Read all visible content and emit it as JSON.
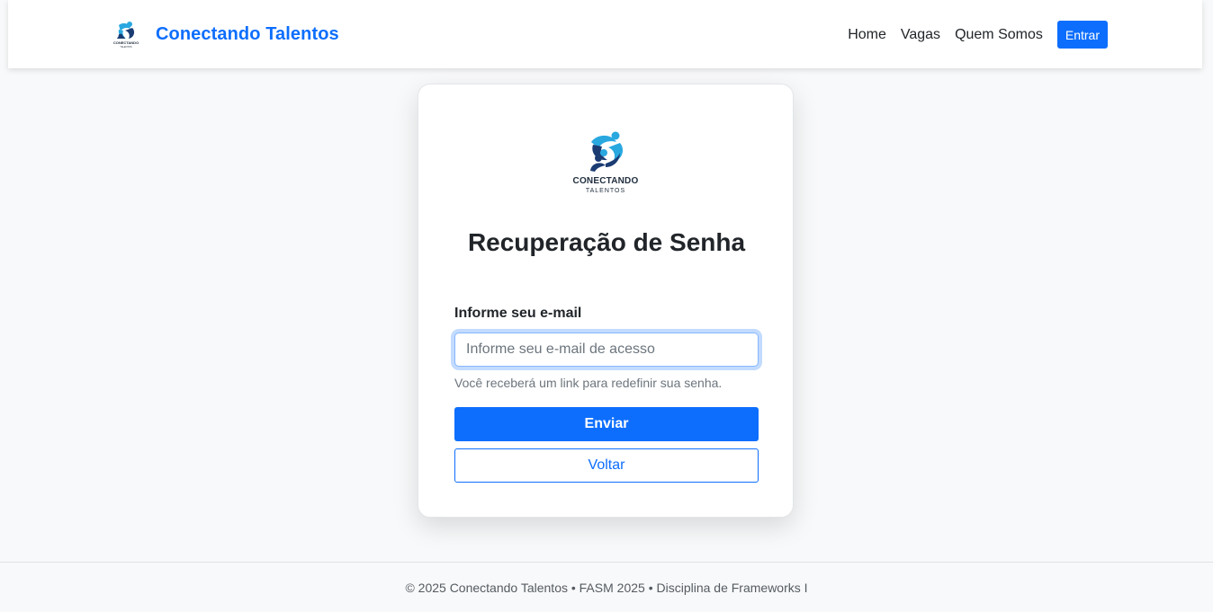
{
  "navbar": {
    "brand_name": "Conectando Talentos",
    "brand_logo_text": "CONECTANDO",
    "brand_logo_subtext": "TALENTOS",
    "links": [
      {
        "label": "Home"
      },
      {
        "label": "Vagas"
      },
      {
        "label": "Quem Somos"
      }
    ],
    "login_button": "Entrar"
  },
  "card": {
    "logo_text": "CONECTANDO",
    "logo_subtext": "TALENTOS",
    "title": "Recuperação de Senha",
    "email_label": "Informe seu e-mail",
    "email_placeholder": "Informe seu e-mail de acesso",
    "email_value": "",
    "help_text": "Você receberá um link para redefinir sua senha.",
    "submit_button": "Enviar",
    "back_button": "Voltar"
  },
  "footer": {
    "text": "© 2025 Conectando Talentos • FASM 2025 • Disciplina de Frameworks I"
  },
  "colors": {
    "primary": "#0d6efd",
    "background": "#f8f9fa",
    "logo_blue": "#29a8e0",
    "logo_navy": "#1b3c73"
  },
  "icons": {
    "brand_logo": "connecting-people-logo"
  }
}
